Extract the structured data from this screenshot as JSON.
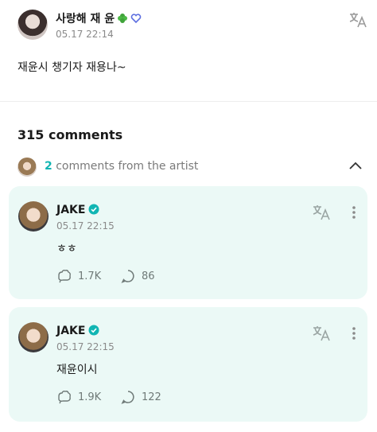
{
  "post": {
    "author": "사랑해 재 윤",
    "timestamp": "05.17 22:14",
    "body": "재윤시 챙기자 재용나~",
    "icons": [
      "avatar",
      "clover-icon",
      "heart-icon",
      "translate-icon"
    ]
  },
  "comments_section": {
    "count_label": "315 comments",
    "artist_count": "2",
    "artist_label": " comments from the artist"
  },
  "comments": [
    {
      "author": "JAKE",
      "timestamp": "05.17 22:15",
      "text": "ㅎㅎ",
      "likes": "1.7K",
      "replies": "86"
    },
    {
      "author": "JAKE",
      "timestamp": "05.17 22:15",
      "text": "재윤이시",
      "likes": "1.9K",
      "replies": "122"
    }
  ],
  "colors": {
    "accent": "#11b5b3",
    "card_bg": "#ebf9f6",
    "muted": "#8a8a8a"
  }
}
